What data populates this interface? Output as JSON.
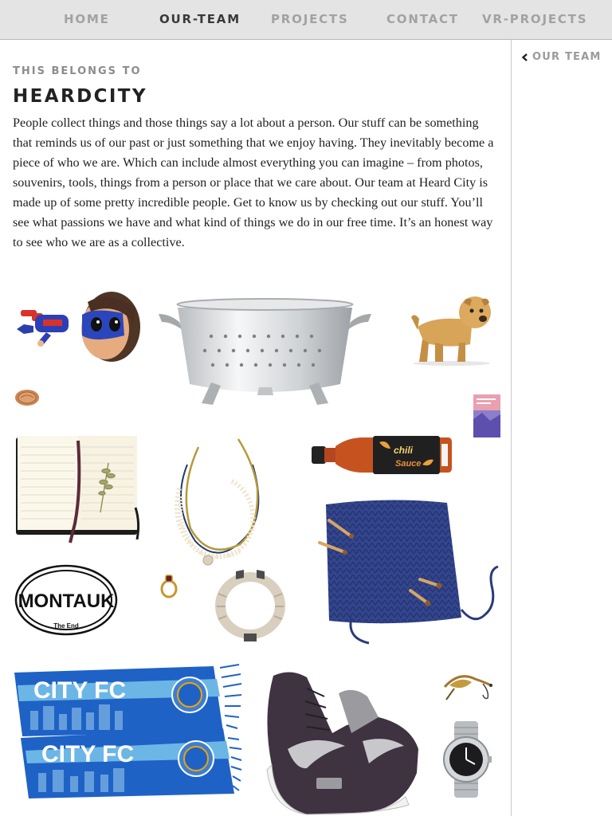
{
  "nav": {
    "items": [
      {
        "label": "HOME",
        "active": false
      },
      {
        "label": "OUR-TEAM",
        "active": true
      },
      {
        "label": "PROJECTS",
        "active": false
      },
      {
        "label": "CONTACT",
        "active": false
      },
      {
        "label": "VR-PROJECTS",
        "active": false
      }
    ]
  },
  "sidebar": {
    "back_icon": "chevron-left-icon",
    "back_label": "OUR TEAM"
  },
  "content": {
    "eyebrow": "THIS BELONGS TO",
    "title": "HEARDCITY",
    "intro": "People collect things and those things say a lot about a person. Our stuff can be something that reminds us of our past or just something that we enjoy having. They inevitably become a piece of who we are. Which can include almost everything you can imagine – from photos, souvenirs, tools, things from a person or place that we care about. Our team at Heard City is made up of some pretty incredible people. Get to know us by checking out our stuff. You’ll see what passions we have and what kind of things we do in our free time. It’s an honest way to see who we are as a collective."
  },
  "collage": {
    "items": [
      {
        "name": "superhero-figurine"
      },
      {
        "name": "metal-colander"
      },
      {
        "name": "dog-figurine"
      },
      {
        "name": "pressed-penny"
      },
      {
        "name": "mini-book"
      },
      {
        "name": "open-notebook"
      },
      {
        "name": "bead-necklaces"
      },
      {
        "name": "hot-sauce-bottle"
      },
      {
        "name": "knitting-project"
      },
      {
        "name": "montauk-sticker"
      },
      {
        "name": "gold-ring"
      },
      {
        "name": "cuff-bracelet"
      },
      {
        "name": "city-fc-scarf"
      },
      {
        "name": "high-top-sneaker"
      },
      {
        "name": "fishing-fly"
      },
      {
        "name": "wristwatch"
      }
    ],
    "labels": {
      "sauce_brand": "chili",
      "sauce_word": "Sauce",
      "sticker_text": "MONTAUK",
      "sticker_sub": "The End",
      "scarf_text": "CITY FC"
    },
    "colors": {
      "scarf_blue": "#1f62c6",
      "scarf_light": "#6cb6e6",
      "knit_blue": "#2f3f86",
      "shoe_dark": "#3f3241"
    }
  }
}
